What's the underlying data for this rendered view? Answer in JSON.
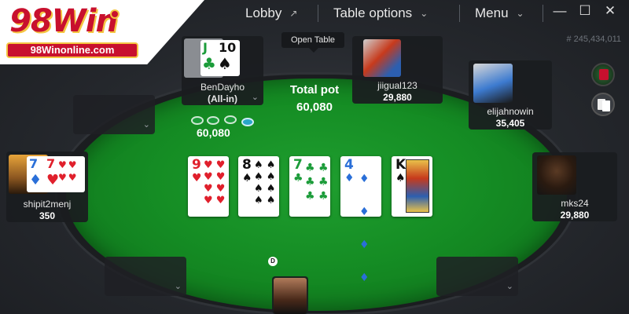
{
  "brand": {
    "name": "98Win",
    "site": "98Winonline.com"
  },
  "menu": {
    "lobby": "Lobby",
    "table_options": "Table options",
    "menu": "Menu"
  },
  "window": {
    "minimize": "—",
    "maximize": "☐",
    "close": "✕"
  },
  "table_id": "# 245,434,011",
  "tooltip": "Open Table",
  "pot": {
    "label": "Total pot",
    "value": "60,080",
    "bet_chips": "60,080"
  },
  "dealer_button": "D",
  "players": [
    {
      "name": "BenDayho",
      "status": "(All-in)",
      "hole_cards": [
        {
          "rank": "J",
          "suit": "♣"
        },
        {
          "rank": "10",
          "suit": "♠"
        }
      ]
    },
    {
      "name": "jiigual123",
      "stack": "29,880"
    },
    {
      "name": "elijahnowin",
      "stack": "35,405"
    },
    {
      "name": "shipit2menj",
      "stack": "350",
      "hole_cards": [
        {
          "rank": "7",
          "suit": "♦"
        },
        {
          "rank": "7",
          "suit": "♥"
        }
      ]
    },
    {
      "name": "mks24",
      "stack": "29,880"
    }
  ],
  "board": [
    {
      "rank": "9",
      "suit": "♥",
      "color": "red"
    },
    {
      "rank": "8",
      "suit": "♠",
      "color": "black"
    },
    {
      "rank": "7",
      "suit": "♣",
      "color": "green"
    },
    {
      "rank": "4",
      "suit": "♦",
      "color": "blue"
    },
    {
      "rank": "K",
      "suit": "♠",
      "color": "black"
    }
  ],
  "colors": {
    "felt": "#158d24",
    "hearts": "#e0202c",
    "clubs": "#1c9c3a",
    "diamonds": "#2a6fd8",
    "brand_red": "#c8102e",
    "brand_gold": "#f5c542"
  }
}
